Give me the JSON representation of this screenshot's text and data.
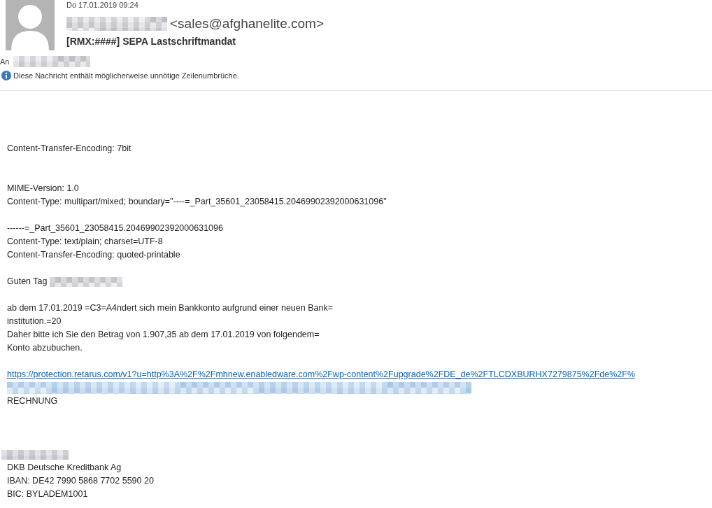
{
  "header": {
    "date": "Do 17.01.2019 09:24",
    "sender_email": "<sales@afghanelite.com>",
    "subject": "[RMX:####] SEPA Lastschriftmandat",
    "to_label": "An",
    "info": "Diese Nachricht enthält möglicherweise unnötige Zeilenumbrüche."
  },
  "body": [
    {
      "kind": "blank"
    },
    {
      "kind": "blank"
    },
    {
      "kind": "blank"
    },
    {
      "kind": "text",
      "text": "Content-Transfer-Encoding: 7bit"
    },
    {
      "kind": "blank"
    },
    {
      "kind": "blank"
    },
    {
      "kind": "text",
      "text": "MIME-Version: 1.0"
    },
    {
      "kind": "text",
      "text": "Content-Type: multipart/mixed; boundary=\"----=_Part_35601_23058415.20469902392000631096\""
    },
    {
      "kind": "blank"
    },
    {
      "kind": "text",
      "text": "------=_Part_35601_23058415.20469902392000631096"
    },
    {
      "kind": "text",
      "text": "Content-Type: text/plain; charset=UTF-8"
    },
    {
      "kind": "text",
      "text": "Content-Transfer-Encoding: quoted-printable"
    },
    {
      "kind": "blank"
    },
    {
      "kind": "greeting",
      "text": "Guten Tag"
    },
    {
      "kind": "blank"
    },
    {
      "kind": "text",
      "text": "ab dem 17.01.2019 =C3=A4ndert sich mein Bankkonto aufgrund einer neuen Bank="
    },
    {
      "kind": "text",
      "text": "institution.=20"
    },
    {
      "kind": "text",
      "text": "Daher bitte ich Sie den Betrag von 1.907,35 ab dem 17.01.2019 von folgendem="
    },
    {
      "kind": "text",
      "text": " Konto abzubuchen."
    },
    {
      "kind": "blank"
    },
    {
      "kind": "link",
      "text": "https://protection.retarus.com/v1?u=http%3A%2F%2Fmhnew.enabledware.com%2Fwp-content%2Fupgrade%2FDE_de%2FTLCDXBURHX7279875%2Fde%2F%"
    },
    {
      "kind": "redacted_link"
    },
    {
      "kind": "text",
      "text": "RECHNUNG"
    },
    {
      "kind": "blank"
    },
    {
      "kind": "blank"
    },
    {
      "kind": "blank"
    },
    {
      "kind": "redacted"
    },
    {
      "kind": "text",
      "text": "DKB Deutsche Kreditbank Ag"
    },
    {
      "kind": "text",
      "text": "IBAN: DE42 7990 5868 7702 5590 20"
    },
    {
      "kind": "text",
      "text": "BIC: BYLADEM1001"
    }
  ]
}
